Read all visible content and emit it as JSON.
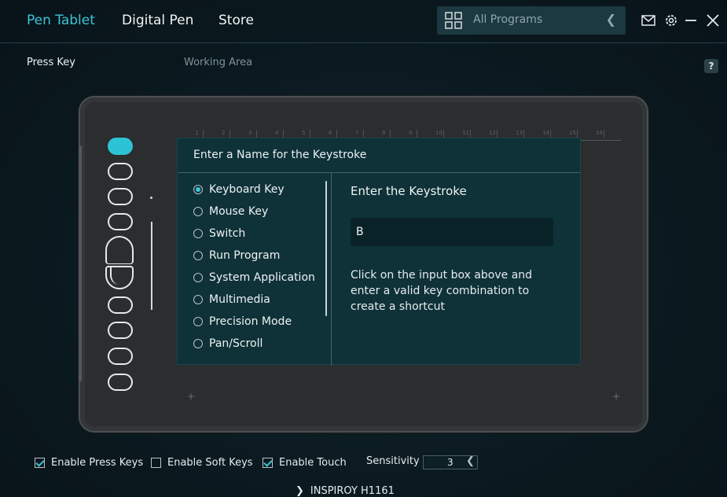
{
  "nav": {
    "tabs": [
      "Pen Tablet",
      "Digital Pen",
      "Store"
    ],
    "active_tab": "Pen Tablet",
    "program_selector": "All Programs"
  },
  "window_icons": [
    "mail-icon",
    "gear-icon",
    "minimize-icon",
    "close-icon"
  ],
  "subtabs": {
    "press_key": "Press Key",
    "working_area": "Working Area",
    "help": "?"
  },
  "tablet": {
    "ruler_labels": [
      "1",
      "2",
      "3",
      "4",
      "5",
      "6",
      "7",
      "8",
      "9",
      "10",
      "11",
      "12",
      "13",
      "14",
      "15",
      "16"
    ]
  },
  "dialog": {
    "title": "Enter a Name for the Keystroke",
    "options": [
      "Keyboard Key",
      "Mouse Key",
      "Switch",
      "Run Program",
      "System Application",
      "Multimedia",
      "Precision Mode",
      "Pan/Scroll"
    ],
    "selected_option": "Keyboard Key",
    "keystroke_title": "Enter the Keystroke",
    "keystroke_value": "B",
    "keystroke_help": "Click on the input box above and enter a valid key combination to create a shortcut"
  },
  "bottom": {
    "enable_press_keys": "Enable Press Keys",
    "enable_soft_keys": "Enable Soft Keys",
    "enable_touch": "Enable Touch",
    "sensitivity_label": "Sensitivity",
    "sensitivity_value": "3",
    "model": "INSPIROY H1161"
  },
  "colors": {
    "accent": "#3fc4d6",
    "dialog_bg": "#0f3138",
    "tablet_body": "#2b2d2f"
  }
}
